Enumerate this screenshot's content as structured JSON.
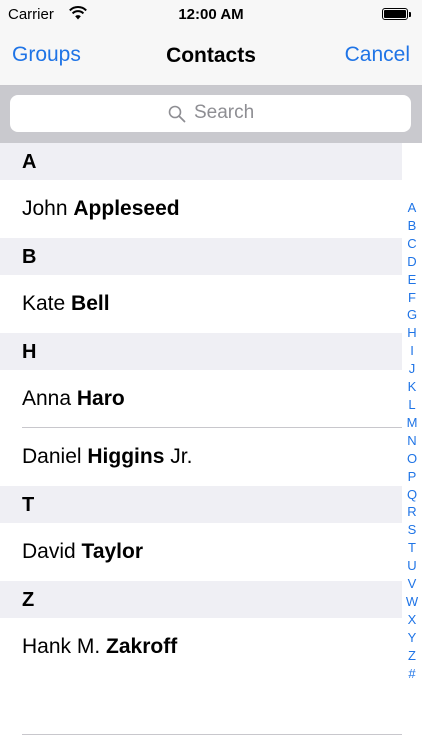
{
  "status_bar": {
    "carrier": "Carrier",
    "time": "12:00 AM"
  },
  "nav": {
    "left": "Groups",
    "title": "Contacts",
    "right": "Cancel"
  },
  "search": {
    "placeholder": "Search"
  },
  "sections": [
    {
      "letter": "A",
      "contacts": [
        {
          "first": "John",
          "last": "Appleseed",
          "suffix": ""
        }
      ]
    },
    {
      "letter": "B",
      "contacts": [
        {
          "first": "Kate",
          "last": "Bell",
          "suffix": ""
        }
      ]
    },
    {
      "letter": "H",
      "contacts": [
        {
          "first": "Anna",
          "last": "Haro",
          "suffix": ""
        },
        {
          "first": "Daniel",
          "last": "Higgins",
          "suffix": "Jr."
        }
      ]
    },
    {
      "letter": "T",
      "contacts": [
        {
          "first": "David",
          "last": "Taylor",
          "suffix": ""
        }
      ]
    },
    {
      "letter": "Z",
      "contacts": [
        {
          "first": "Hank M.",
          "last": "Zakroff",
          "suffix": ""
        }
      ]
    }
  ],
  "index_letters": [
    "A",
    "B",
    "C",
    "D",
    "E",
    "F",
    "G",
    "H",
    "I",
    "J",
    "K",
    "L",
    "M",
    "N",
    "O",
    "P",
    "Q",
    "R",
    "S",
    "T",
    "U",
    "V",
    "W",
    "X",
    "Y",
    "Z",
    "#"
  ],
  "colors": {
    "tint": "#1f74e6",
    "section_bg": "#efeff4",
    "search_bg": "#c9c9ce"
  }
}
